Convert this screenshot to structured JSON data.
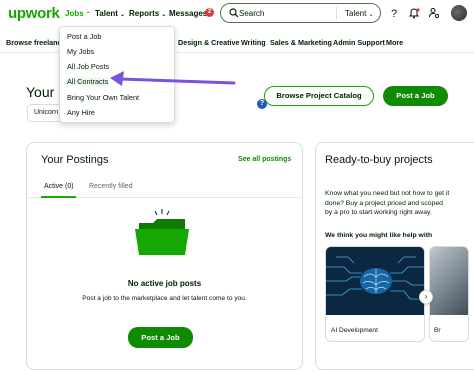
{
  "header": {
    "logo": "upwork",
    "nav": [
      {
        "label": "Jobs",
        "active": true
      },
      {
        "label": "Talent",
        "active": false
      },
      {
        "label": "Reports",
        "active": false
      },
      {
        "label": "Messages",
        "active": false
      }
    ],
    "messages_badge": "2",
    "search": {
      "placeholder": "Search",
      "scope": "Talent"
    },
    "icons": [
      "help-icon",
      "bell-icon",
      "user-settings-icon",
      "avatar"
    ]
  },
  "subnav": {
    "items": [
      "Browse freelance",
      "Design & Creative",
      "Writing",
      "Sales & Marketing",
      "Admin Support",
      "More"
    ]
  },
  "jobs_menu": {
    "items": [
      "Post a Job",
      "My Jobs",
      "All Job Posts",
      "All Contracts",
      "Bring Your Own Talent",
      "Any Hire"
    ],
    "highlighted": "All Contracts"
  },
  "welcome": {
    "title": "Your D",
    "chip": "Unicorn"
  },
  "actions": {
    "browse_catalog": "Browse Project Catalog",
    "post_job": "Post a Job"
  },
  "postings": {
    "title": "Your Postings",
    "see_all": "See all postings",
    "tabs": [
      {
        "label": "Active (0)",
        "active": true
      },
      {
        "label": "Recently filled",
        "active": false
      }
    ],
    "empty_title": "No active job posts",
    "empty_desc": "Post a job to the marketplace and let talent come to you.",
    "button": "Post a Job"
  },
  "ready_to_buy": {
    "title": "Ready-to-buy projects",
    "desc": "Know what you need but not how to get it done? Buy a project priced and scoped by a pro to start working right away.",
    "subtitle": "We think you might like help with",
    "projects": [
      {
        "label": "AI Development"
      },
      {
        "label": "Br"
      }
    ]
  },
  "colors": {
    "brand": "#14a800",
    "button": "#108a00",
    "arrow": "#7b52e0"
  }
}
